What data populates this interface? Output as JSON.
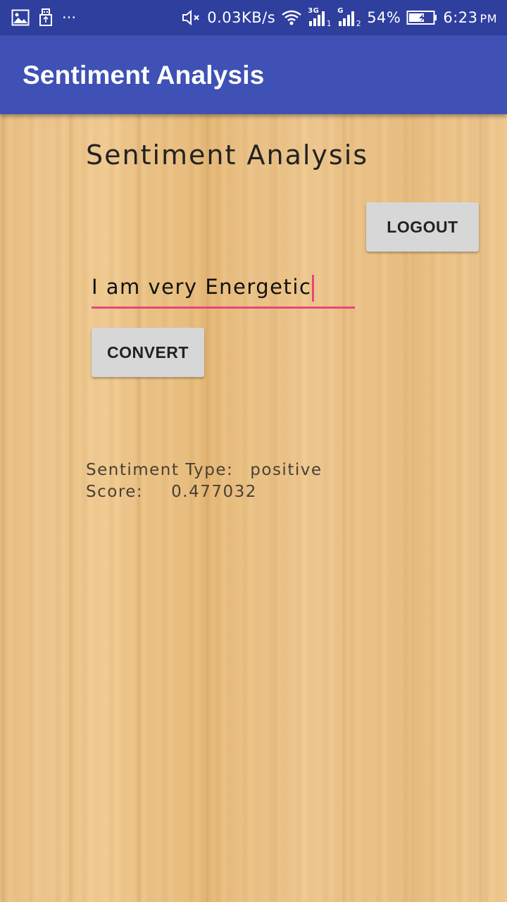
{
  "status_bar": {
    "icons_left": [
      "image-icon",
      "usb-icon",
      "more-dots-icon"
    ],
    "dots": "···",
    "net_speed": "0.03KB/s",
    "network_3g": "3G",
    "network_g": "G",
    "sim1": "1",
    "sim2": "2",
    "battery_percent": "54%",
    "time": "6:23",
    "time_suffix": "PM"
  },
  "app_bar": {
    "title": "Sentiment Analysis"
  },
  "main": {
    "heading": "Sentiment Analysis",
    "logout_label": "LOGOUT",
    "input_value": "I am very Energetic",
    "convert_label": "CONVERT",
    "result_type_label": "Sentiment Type:",
    "result_type_value": "positive",
    "result_score_label": "Score:",
    "result_score_value": "0.477032"
  },
  "colors": {
    "status_bar": "#2f3f9e",
    "app_bar": "#3f51b5",
    "accent": "#e8457c",
    "button": "#d7d7d7"
  }
}
